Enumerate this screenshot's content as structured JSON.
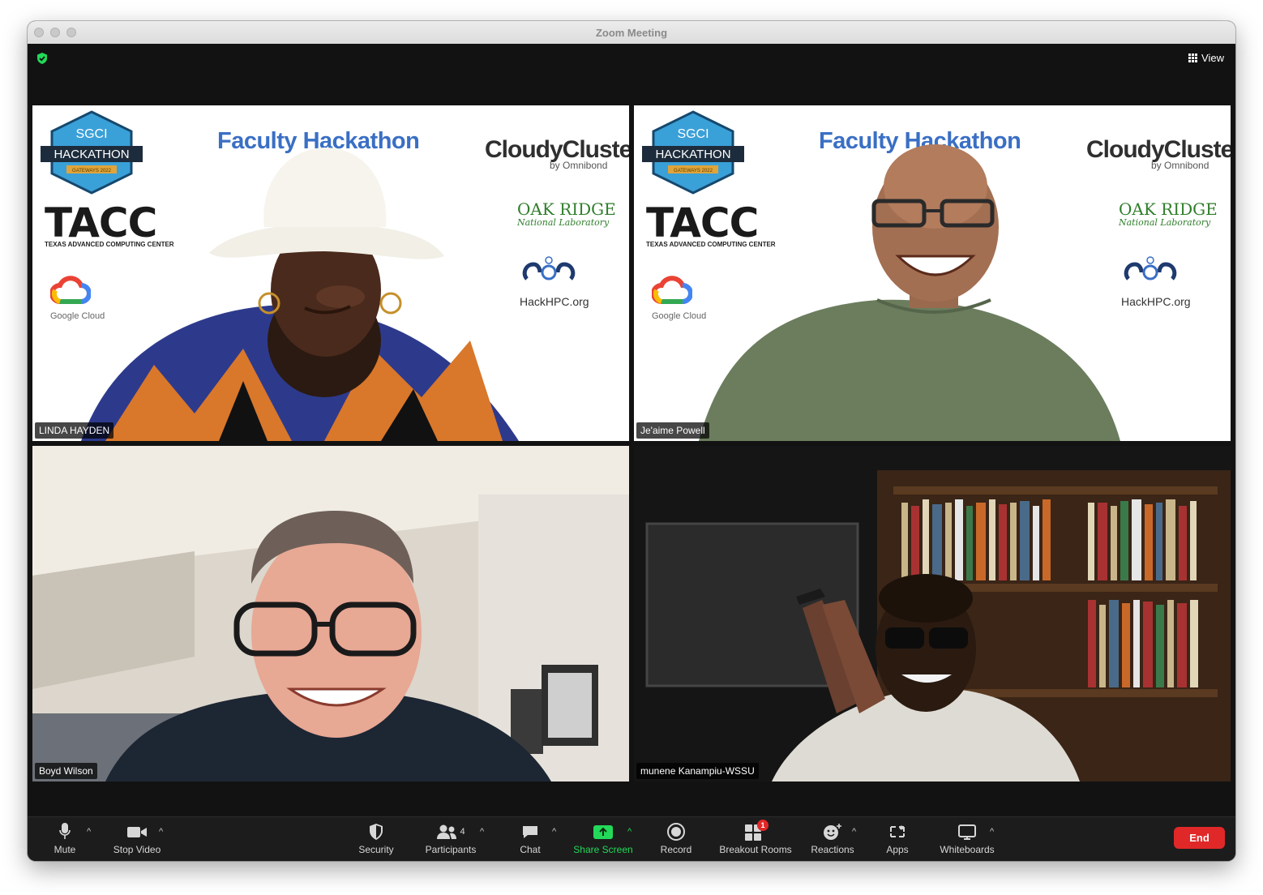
{
  "window": {
    "title": "Zoom Meeting"
  },
  "header": {
    "view_label": "View",
    "security_icon": "shield-check-icon",
    "accent": "#23d959"
  },
  "banner": {
    "title": "Faculty Hackathon",
    "sgci_top": "SGCI",
    "sgci_main": "HACKATHON",
    "sgci_sub": "GATEWAYS 2022",
    "tacc": "TACC",
    "tacc_sub": "TEXAS ADVANCED COMPUTING CENTER",
    "google_cloud": "Google Cloud",
    "cloudy": "CloudyCluster",
    "cloudy_sub": "by Omnibond",
    "oak": "OAK RIDGE",
    "oak_sub": "National Laboratory",
    "hackhpc": "HackHPC.org"
  },
  "participants": [
    {
      "name": "LINDA HAYDEN",
      "active": false
    },
    {
      "name": "Je'aime Powell",
      "active": false
    },
    {
      "name": "Boyd Wilson",
      "active": false
    },
    {
      "name": "munene Kanampiu-WSSU",
      "active": true
    }
  ],
  "toolbar": {
    "mute": "Mute",
    "stop_video": "Stop Video",
    "security": "Security",
    "participants": "Participants",
    "participants_count": "4",
    "chat": "Chat",
    "share_screen": "Share Screen",
    "record": "Record",
    "breakout_rooms": "Breakout Rooms",
    "breakout_badge": "1",
    "reactions": "Reactions",
    "apps": "Apps",
    "whiteboards": "Whiteboards",
    "end": "End"
  },
  "colors": {
    "share_green": "#23d959",
    "end_red": "#e02828",
    "active_border": "#23d959"
  }
}
